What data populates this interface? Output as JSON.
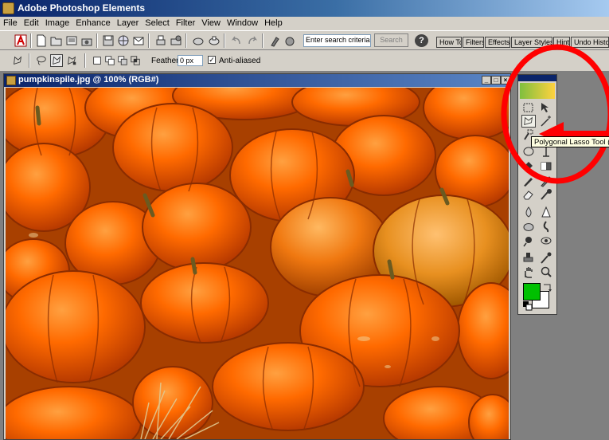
{
  "app": {
    "title": "Adobe Photoshop Elements"
  },
  "menu": [
    "File",
    "Edit",
    "Image",
    "Enhance",
    "Layer",
    "Select",
    "Filter",
    "View",
    "Window",
    "Help"
  ],
  "toolbar": {
    "search_value": "Enter search criteria",
    "search_button": "Search",
    "help_label": "?",
    "palette_tabs": [
      "How To",
      "Filters",
      "Effects",
      "Layer Styles",
      "Hints",
      "Undo History"
    ]
  },
  "options": {
    "feather_label": "Feather:",
    "feather_value": "0 px",
    "anti_aliased_label": "Anti-aliased",
    "anti_aliased_checked": true
  },
  "document": {
    "title": "pumpkinspile.jpg @ 100% (RGB#)",
    "minimize": "_",
    "maximize": "□",
    "close": "×"
  },
  "toolbox": {
    "tooltip": "Polygonal Lasso Tool (L)",
    "foreground_color": "#00c000",
    "background_color": "#ffffff"
  },
  "annotation": {
    "circle_color": "#ff0000",
    "arrow_color": "#ff0000"
  }
}
